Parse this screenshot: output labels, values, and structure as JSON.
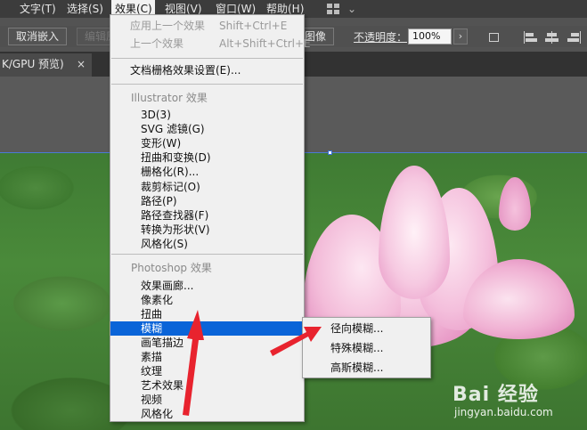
{
  "menubar": {
    "items": [
      "文字(T)",
      "选择(S)",
      "效果(C)",
      "视图(V)",
      "窗口(W)",
      "帮助(H)"
    ]
  },
  "controlbar": {
    "cancel_embed": "取消嵌入",
    "edit_original": "编辑原",
    "image_trace": "图像",
    "opacity_label": "不透明度：",
    "opacity_value": "100%",
    "arrow": "›"
  },
  "tab": {
    "label": "K/GPU 预览)",
    "close": "×"
  },
  "effect_menu": {
    "apply_last": {
      "label": "应用上一个效果",
      "shortcut": "Shift+Ctrl+E"
    },
    "last_effect": {
      "label": "上一个效果",
      "shortcut": "Alt+Shift+Ctrl+E"
    },
    "doc_raster_settings": "文档栅格效果设置(E)...",
    "illustrator_header": "Illustrator 效果",
    "illustrator_items": [
      "3D(3)",
      "SVG 滤镜(G)",
      "变形(W)",
      "扭曲和变换(D)",
      "栅格化(R)...",
      "裁剪标记(O)",
      "路径(P)",
      "路径查找器(F)",
      "转换为形状(V)",
      "风格化(S)"
    ],
    "photoshop_header": "Photoshop 效果",
    "photoshop_items": [
      "效果画廊...",
      "像素化",
      "扭曲",
      "模糊",
      "画笔描边",
      "素描",
      "纹理",
      "艺术效果",
      "视频",
      "风格化"
    ]
  },
  "blur_submenu": {
    "items": [
      "径向模糊...",
      "特殊模糊...",
      "高斯模糊..."
    ]
  },
  "watermark": {
    "logo": "Bai 经验",
    "url": "jingyan.baidu.com"
  },
  "colors": {
    "highlight": "#0a64d8",
    "annotation_red": "#e8232e"
  }
}
